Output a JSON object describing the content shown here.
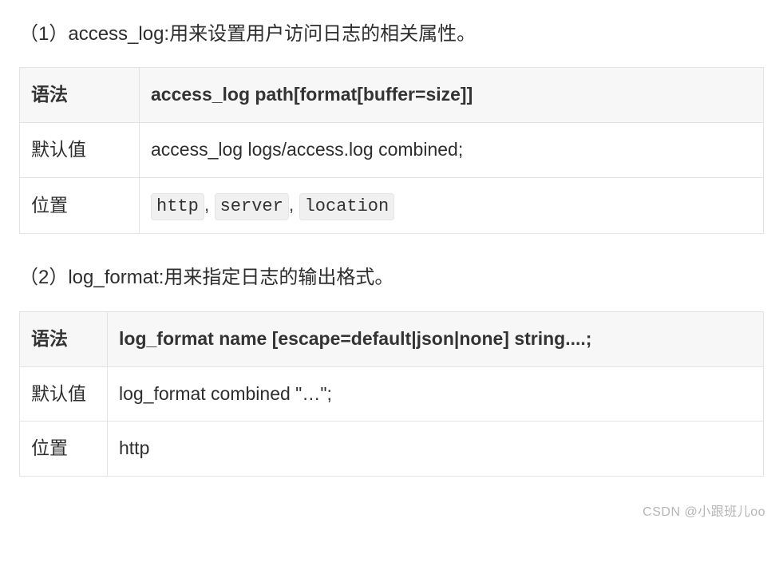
{
  "sections": [
    {
      "title": "（1）access_log:用来设置用户访问日志的相关属性。",
      "table": {
        "header_label": "语法",
        "header_value": "access_log path[format[buffer=size]]",
        "rows": [
          {
            "label": "默认值",
            "type": "text",
            "value": "access_log logs/access.log combined;"
          },
          {
            "label": "位置",
            "type": "codes",
            "codes": [
              "http",
              "server",
              "location"
            ],
            "sep": ", "
          }
        ]
      }
    },
    {
      "title": "（2）log_format:用来指定日志的输出格式。",
      "table": {
        "header_label": "语法",
        "header_value": "log_format name [escape=default|json|none] string....;",
        "rows": [
          {
            "label": "默认值",
            "type": "text",
            "value": "log_format combined \"…\";"
          },
          {
            "label": "位置",
            "type": "text",
            "value": "http"
          }
        ]
      }
    }
  ],
  "watermark": "CSDN @小跟班儿oo"
}
